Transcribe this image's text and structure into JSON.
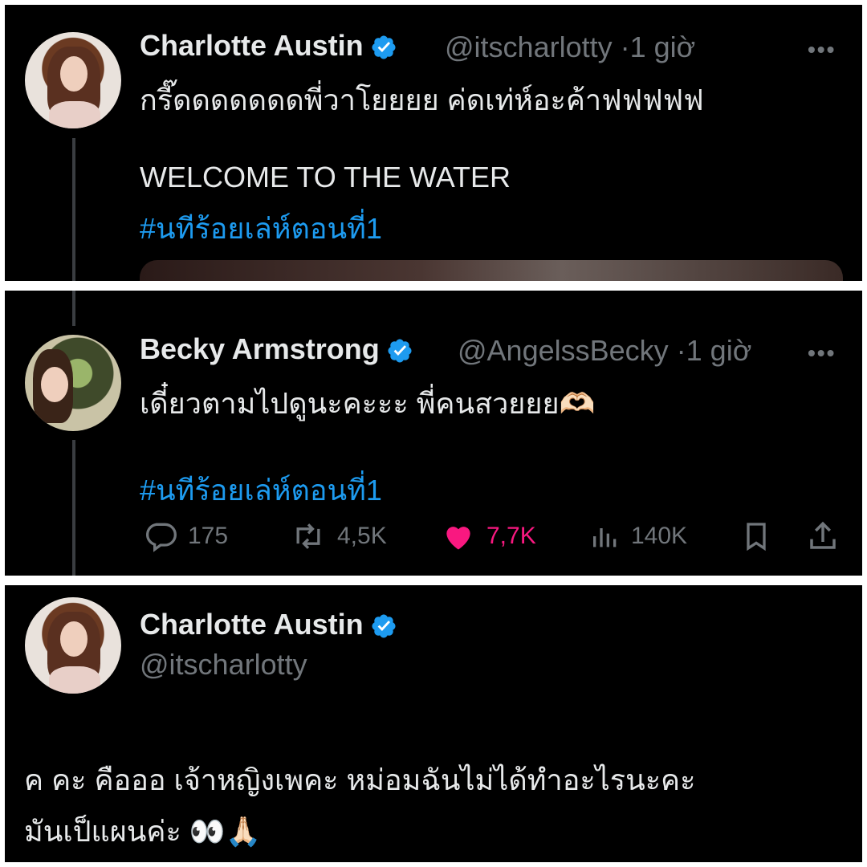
{
  "colors": {
    "background": "#000000",
    "text": "#e7e9ea",
    "muted": "#71767b",
    "link": "#1d9bf0",
    "like": "#f91880",
    "verified": "#1d9bf0"
  },
  "tweets": [
    {
      "author": {
        "name": "Charlotte Austin",
        "handle": "@itscharlotty",
        "verified": true,
        "avatar": "charlotte-avatar"
      },
      "time": "·1 giờ",
      "more_icon": "•••",
      "lines": [
        "กรี๊ดดดดดดดพี่วาโยยยย ค่ดเท่ห์อะค้าฟฟฟฟฟ",
        "WELCOME TO THE WATER"
      ],
      "hashtag": "#นทีร้อยเล่ห์ตอนที่1"
    },
    {
      "author": {
        "name": "Becky Armstrong",
        "handle": "@AngelssBecky",
        "verified": true,
        "avatar": "becky-avatar"
      },
      "time": "·1 giờ",
      "more_icon": "•••",
      "lines": [
        "เดี๋ยวตามไปดูนะคะะะ พี่คนสวยยย🫶🏻"
      ],
      "hashtag": "#นทีร้อยเล่ห์ตอนที่1",
      "stats": {
        "replies": "175",
        "retweets": "4,5K",
        "likes": "7,7K",
        "views": "140K"
      }
    },
    {
      "author": {
        "name": "Charlotte Austin",
        "handle": "@itscharlotty",
        "verified": true,
        "avatar": "charlotte-avatar"
      },
      "lines": [
        "ค คะ คือออ เจ้าหญิงเพคะ หม่อมฉันไม่ได้ทำอะไรนะคะ",
        "มันเป็แผนค่ะ 👀🙏🏻"
      ]
    }
  ]
}
